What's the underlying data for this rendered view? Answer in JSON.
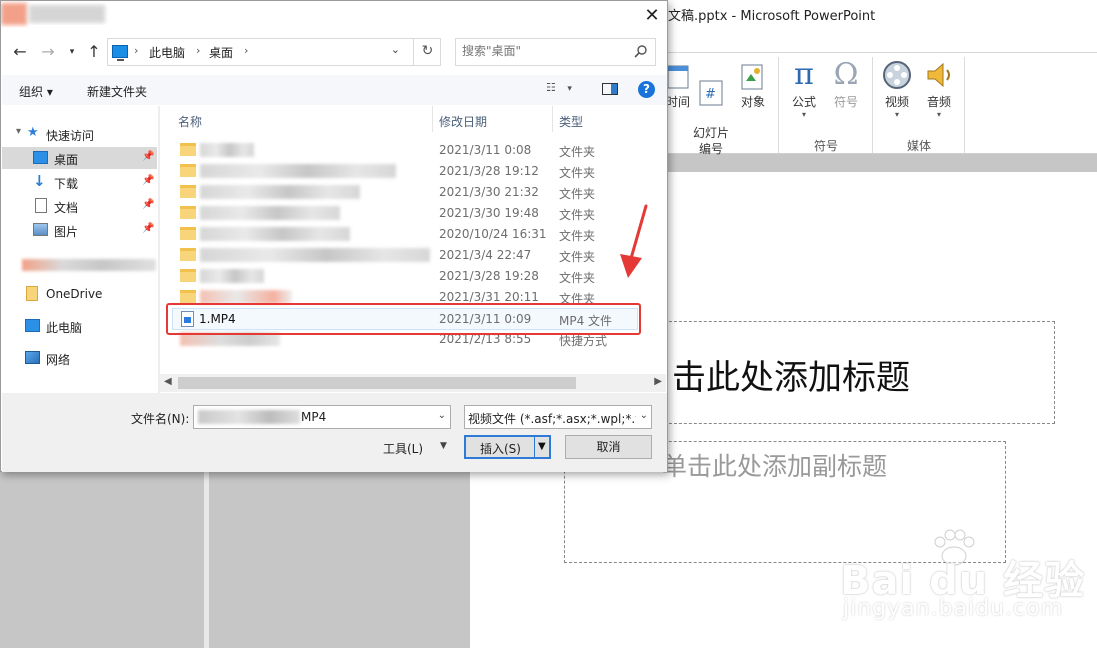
{
  "powerpoint": {
    "window_title": "文稿.pptx - Microsoft PowerPoint",
    "ribbon": {
      "time_label": "时间",
      "slide_number_label": "幻灯片\n编号",
      "object_label": "对象",
      "equation_label": "公式",
      "symbol_label": "符号",
      "symbols_group": "符号",
      "video_label": "视频",
      "audio_label": "音频",
      "media_group": "媒体"
    },
    "slide": {
      "title_placeholder": "击此处添加标题",
      "subtitle_placeholder": "单击此处添加副标题"
    }
  },
  "dialog": {
    "address": {
      "crumbs": [
        "此电脑",
        "桌面"
      ]
    },
    "search": {
      "placeholder": "搜索\"桌面\""
    },
    "toolbar": {
      "organize": "组织 ▾",
      "new_folder": "新建文件夹"
    },
    "nav": {
      "quick_access": "快速访问",
      "items": [
        "桌面",
        "下载",
        "文档",
        "图片"
      ],
      "onedrive": "OneDrive",
      "this_pc": "此电脑",
      "network": "网络"
    },
    "columns": {
      "name": "名称",
      "date": "修改日期",
      "type": "类型"
    },
    "rows": [
      {
        "date": "2021/3/11 0:08",
        "type": "文件夹"
      },
      {
        "date": "2021/3/28 19:12",
        "type": "文件夹"
      },
      {
        "date": "2021/3/30 21:32",
        "type": "文件夹"
      },
      {
        "date": "2021/3/30 19:48",
        "type": "文件夹"
      },
      {
        "date": "2020/10/24 16:31",
        "type": "文件夹"
      },
      {
        "date": "2021/3/4 22:47",
        "type": "文件夹"
      },
      {
        "date": "2021/3/28 19:28",
        "type": "文件夹"
      },
      {
        "date": "2021/3/31 20:11",
        "type": "文件夹"
      },
      {
        "name": "1.MP4",
        "date": "2021/3/11 0:09",
        "type": "MP4 文件"
      },
      {
        "date": "2021/2/13 8:55",
        "type": "快捷方式"
      }
    ],
    "file_name_label": "文件名(N):",
    "file_name_value": "MP4",
    "file_type_value": "视频文件 (*.asf;*.asx;*.wpl;*.wm",
    "tools_label": "工具(L)",
    "insert_label": "插入(S)",
    "cancel_label": "取消"
  },
  "watermark": {
    "main": "Bai du 经验",
    "sub": "jingyan.baidu.com"
  },
  "colors": {
    "highlight": "#e53935",
    "accent": "#2d7bd6"
  }
}
